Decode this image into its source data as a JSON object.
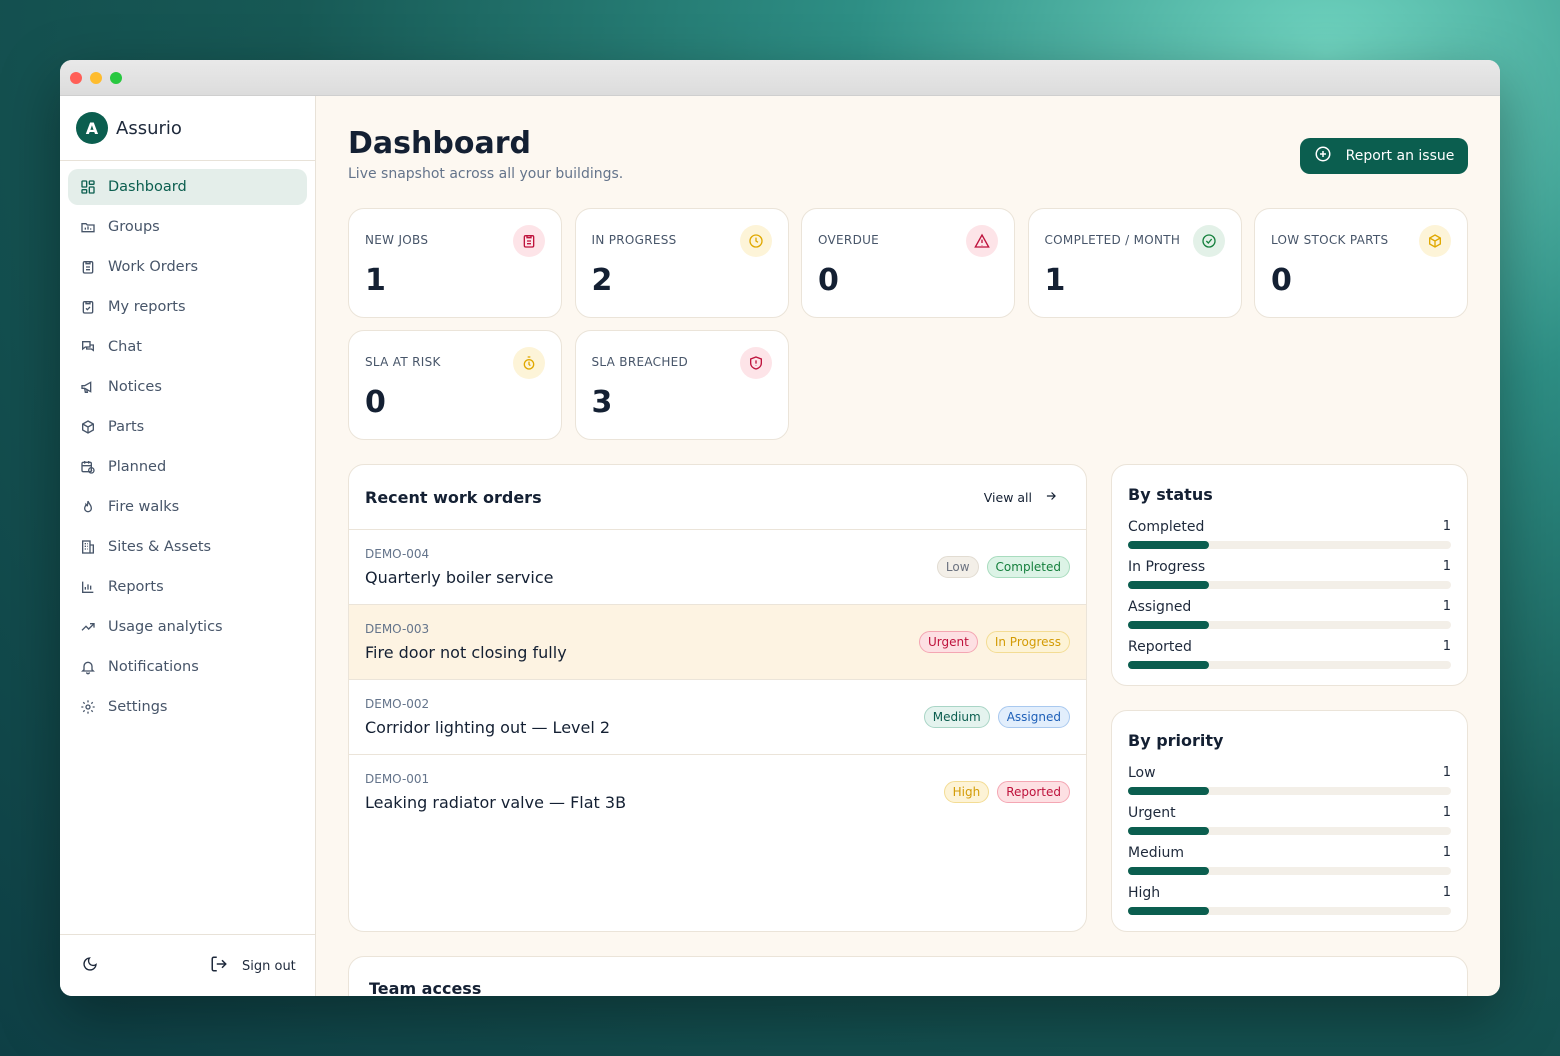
{
  "brand": {
    "logo_letter": "A",
    "name": "Assurio"
  },
  "nav": [
    {
      "label": "Dashboard",
      "icon": "dashboard-icon",
      "active": true
    },
    {
      "label": "Groups",
      "icon": "groups-icon"
    },
    {
      "label": "Work Orders",
      "icon": "clipboard-icon"
    },
    {
      "label": "My reports",
      "icon": "clipboard-check-icon"
    },
    {
      "label": "Chat",
      "icon": "chat-icon"
    },
    {
      "label": "Notices",
      "icon": "megaphone-icon"
    },
    {
      "label": "Parts",
      "icon": "package-icon"
    },
    {
      "label": "Planned",
      "icon": "calendar-clock-icon"
    },
    {
      "label": "Fire walks",
      "icon": "flame-icon"
    },
    {
      "label": "Sites & Assets",
      "icon": "building-icon"
    },
    {
      "label": "Reports",
      "icon": "bar-chart-icon"
    },
    {
      "label": "Usage analytics",
      "icon": "trending-up-icon"
    },
    {
      "label": "Notifications",
      "icon": "bell-icon"
    },
    {
      "label": "Settings",
      "icon": "gear-icon"
    }
  ],
  "footer": {
    "theme_icon": "moon-icon",
    "sign_out_label": "Sign out"
  },
  "header": {
    "title": "Dashboard",
    "subtitle": "Live snapshot across all your buildings.",
    "report_button": "Report an issue"
  },
  "stats": [
    {
      "label": "NEW JOBS",
      "value": "1",
      "icon": "clipboard-icon",
      "color": "#be123c",
      "bg": "#fde4e8"
    },
    {
      "label": "IN PROGRESS",
      "value": "2",
      "icon": "clock-icon",
      "color": "#e0a800",
      "bg": "#fdf4d8"
    },
    {
      "label": "OVERDUE",
      "value": "0",
      "icon": "alert-triangle-icon",
      "color": "#be123c",
      "bg": "#fde4e8"
    },
    {
      "label": "COMPLETED / MONTH",
      "value": "1",
      "icon": "check-circle-icon",
      "color": "#15803d",
      "bg": "#e3f1e8"
    },
    {
      "label": "LOW STOCK PARTS",
      "value": "0",
      "icon": "package-icon",
      "color": "#e0a800",
      "bg": "#fdf4d8"
    },
    {
      "label": "SLA AT RISK",
      "value": "0",
      "icon": "timer-icon",
      "color": "#e0a800",
      "bg": "#fdf4d8"
    },
    {
      "label": "SLA BREACHED",
      "value": "3",
      "icon": "shield-alert-icon",
      "color": "#be123c",
      "bg": "#fde4e8"
    }
  ],
  "recent_orders": {
    "title": "Recent work orders",
    "view_all": "View all",
    "rows": [
      {
        "id": "DEMO-004",
        "title": "Quarterly boiler service",
        "priority": "Low",
        "status": "Completed"
      },
      {
        "id": "DEMO-003",
        "title": "Fire door not closing fully",
        "priority": "Urgent",
        "status": "In Progress"
      },
      {
        "id": "DEMO-002",
        "title": "Corridor lighting out — Level 2",
        "priority": "Medium",
        "status": "Assigned"
      },
      {
        "id": "DEMO-001",
        "title": "Leaking radiator valve — Flat 3B",
        "priority": "High",
        "status": "Reported"
      }
    ]
  },
  "by_status": {
    "title": "By status",
    "max": 4,
    "items": [
      {
        "label": "Completed",
        "count": 1
      },
      {
        "label": "In Progress",
        "count": 1
      },
      {
        "label": "Assigned",
        "count": 1
      },
      {
        "label": "Reported",
        "count": 1
      }
    ]
  },
  "by_priority": {
    "title": "By priority",
    "max": 4,
    "items": [
      {
        "label": "Low",
        "count": 1
      },
      {
        "label": "Urgent",
        "count": 1
      },
      {
        "label": "Medium",
        "count": 1
      },
      {
        "label": "High",
        "count": 1
      }
    ]
  },
  "team_access": {
    "title": "Team access"
  },
  "colors": {
    "accent": "#0b5e4f",
    "background": "#fdf8f1"
  }
}
